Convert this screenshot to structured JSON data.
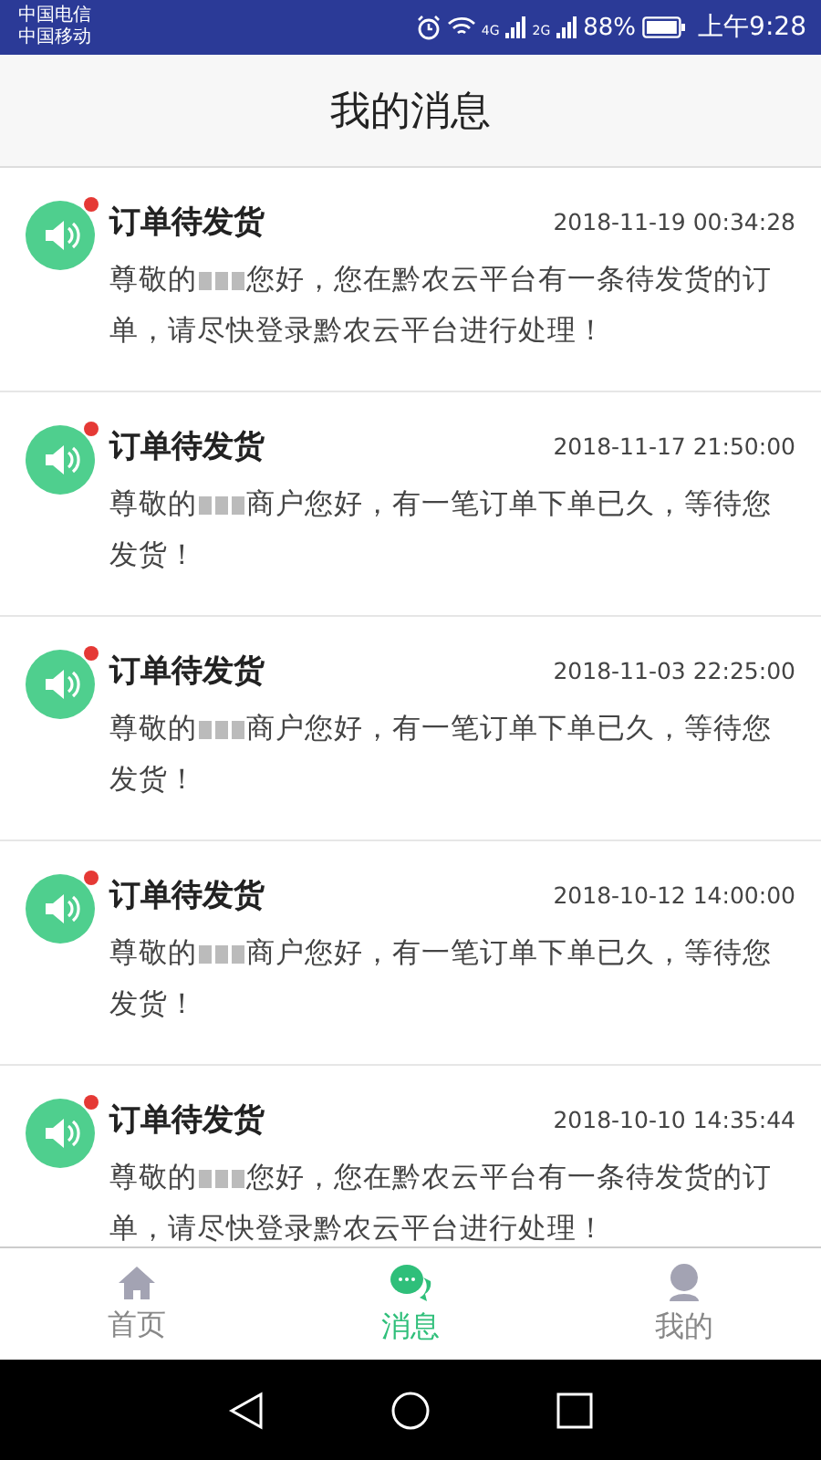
{
  "status_bar": {
    "carriers": [
      "中国电信",
      "中国移动"
    ],
    "network_1": "4G",
    "network_2": "2G",
    "battery": "88%",
    "time": "上午9:28"
  },
  "header": {
    "title": "我的消息"
  },
  "messages": [
    {
      "title": "订单待发货",
      "time": "2018-11-19 00:34:28",
      "unread": true,
      "greeting": "尊敬的",
      "body": "您好，您在黔农云平台有一条待发货的订单，请尽快登录黔农云平台进行处理！"
    },
    {
      "title": "订单待发货",
      "time": "2018-11-17 21:50:00",
      "unread": true,
      "greeting": "尊敬的",
      "body": "商户您好，有一笔订单下单已久，等待您发货！"
    },
    {
      "title": "订单待发货",
      "time": "2018-11-03 22:25:00",
      "unread": true,
      "greeting": "尊敬的",
      "body": "商户您好，有一笔订单下单已久，等待您发货！"
    },
    {
      "title": "订单待发货",
      "time": "2018-10-12 14:00:00",
      "unread": true,
      "greeting": "尊敬的",
      "body": "商户您好，有一笔订单下单已久，等待您发货！"
    },
    {
      "title": "订单待发货",
      "time": "2018-10-10 14:35:44",
      "unread": true,
      "greeting": "尊敬的",
      "body": "您好，您在黔农云平台有一条待发货的订单，请尽快登录黔农云平台进行处理！"
    }
  ],
  "tabs": [
    {
      "label": "首页",
      "kind": "home",
      "selected": false
    },
    {
      "label": "消息",
      "kind": "chat",
      "selected": true
    },
    {
      "label": "我的",
      "kind": "user",
      "selected": false
    }
  ]
}
